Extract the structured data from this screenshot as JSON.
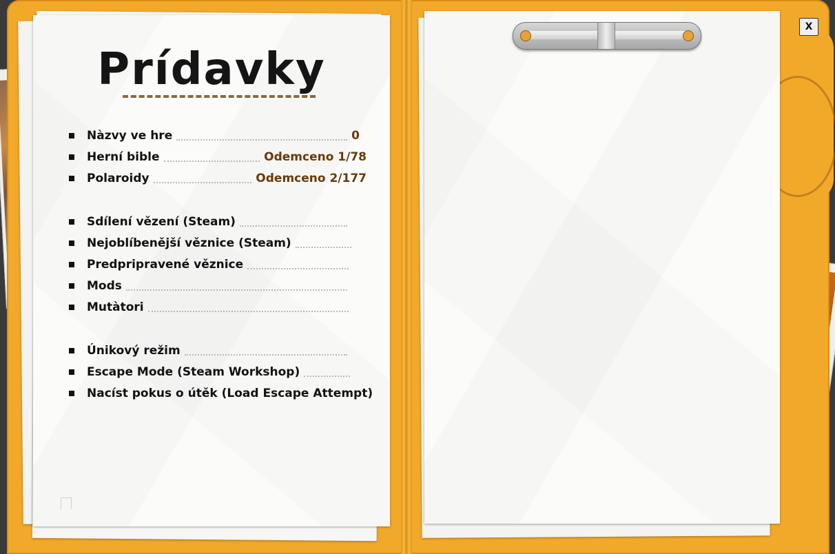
{
  "window": {
    "title": "Prídavky",
    "close_label": "X"
  },
  "colors": {
    "folder": "#f2a92a",
    "value_text": "#6a3a08",
    "paper": "#fbfbfa"
  },
  "menu": {
    "group1": [
      {
        "label": "Nàzvy ve hre",
        "value": "0"
      },
      {
        "label": "Herní bible",
        "value": "Odemceno 1/78"
      },
      {
        "label": "Polaroidy",
        "value": "Odemceno 2/177"
      }
    ],
    "group2": [
      {
        "label": "Sdílení vězení (Steam)"
      },
      {
        "label": "Nejoblíbenější věznice (Steam)"
      },
      {
        "label": "Predpripravené věznice"
      },
      {
        "label": "Mods"
      },
      {
        "label": "Mutàtori"
      }
    ],
    "group3": [
      {
        "label": "Únikový režim"
      },
      {
        "label": "Escape Mode (Steam Workshop)"
      },
      {
        "label": "Nacíst pokus o útěk (Load Escape Attempt)"
      }
    ]
  }
}
